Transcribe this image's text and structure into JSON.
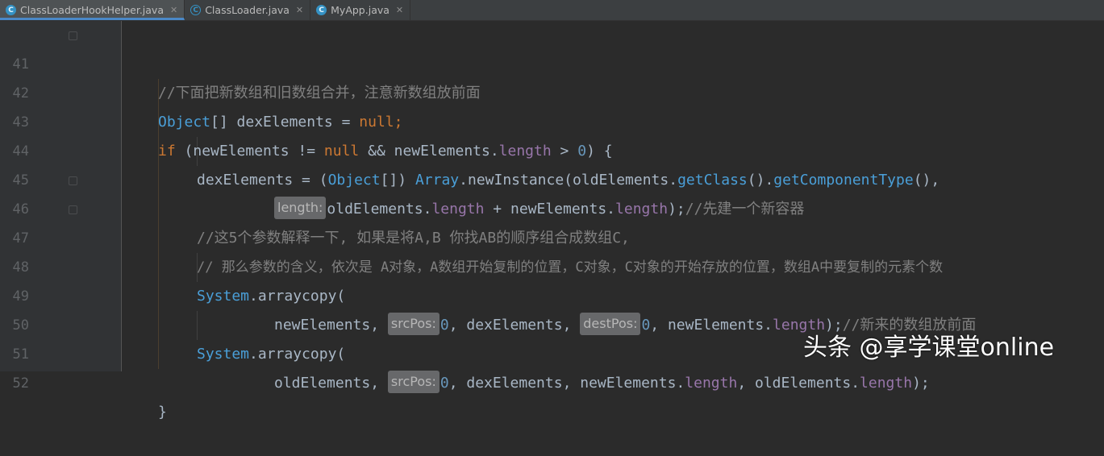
{
  "tabs": [
    {
      "label": "ClassLoaderHookHelper.java",
      "icon": "C",
      "active": true
    },
    {
      "label": "ClassLoader.java",
      "icon": "C",
      "active": false
    },
    {
      "label": "MyApp.java",
      "icon": "C",
      "active": false
    }
  ],
  "tab_close": "✕",
  "lines": [
    {
      "n": "41"
    },
    {
      "n": "42"
    },
    {
      "n": "43"
    },
    {
      "n": "44"
    },
    {
      "n": "45"
    },
    {
      "n": "46"
    },
    {
      "n": "47"
    },
    {
      "n": "48"
    },
    {
      "n": "49"
    },
    {
      "n": "50"
    },
    {
      "n": "51"
    },
    {
      "n": "52"
    }
  ],
  "code": {
    "l41": {
      "comment": "//下面把新数组和旧数组合并，注意新数组放前面"
    },
    "l42": {
      "t1": "Object",
      "t2": "[] dexElements = ",
      "t3": "null",
      "t4": ";"
    },
    "l43": {
      "t1": "if",
      "t2": " (newElements != ",
      "t3": "null",
      "t4": " && newElements.",
      "t5": "length",
      "t6": " > ",
      "t7": "0",
      "t8": ") {"
    },
    "l44": {
      "t1": "dexElements = (",
      "t2": "Object",
      "t3": "[]) ",
      "t4": "Array",
      "t5": ".newInstance(oldElements.",
      "t6": "getClass",
      "t7": "().",
      "t8": "getComponentType",
      "t9": "(),"
    },
    "l45": {
      "hint": "length:",
      "t1": "oldElements.",
      "t2": "length",
      "t3": " + newElements.",
      "t4": "length",
      "t5": ");",
      "comment": "//先建一个新容器"
    },
    "l46": {
      "comment": "//这5个参数解释一下, 如果是将A,B 你找AB的顺序组合成数组C,"
    },
    "l47": {
      "comment": "// 那么参数的含义，依次是 A对象，A数组开始复制的位置，C对象，C对象的开始存放的位置，数组A中要复制的元素个数"
    },
    "l48": {
      "t1": "System",
      "t2": ".arraycopy("
    },
    "l49": {
      "t1": "newElements, ",
      "hint1": "srcPos:",
      "t2": "0",
      "t3": ", dexElements, ",
      "hint2": "destPos:",
      "t4": "0",
      "t5": ", newElements.",
      "t6": "length",
      "t7": ");",
      "comment": "//新来的数组放前面"
    },
    "l50": {
      "t1": "System",
      "t2": ".arraycopy("
    },
    "l51": {
      "t1": "oldElements, ",
      "hint1": "srcPos:",
      "t2": "0",
      "t3": ", dexElements, newElements.",
      "t4": "length",
      "t5": ", oldElements.",
      "t6": "length",
      "t7": ");"
    },
    "l52": {
      "t1": "}"
    }
  },
  "watermark": "头条 @享学课堂online",
  "colors": {
    "background": "#2b2b2b",
    "keyword": "#cc7832",
    "class": "#4a9fd8",
    "number": "#6897bb",
    "field": "#9876aa",
    "comment": "#808080",
    "text": "#a9b7c6"
  }
}
